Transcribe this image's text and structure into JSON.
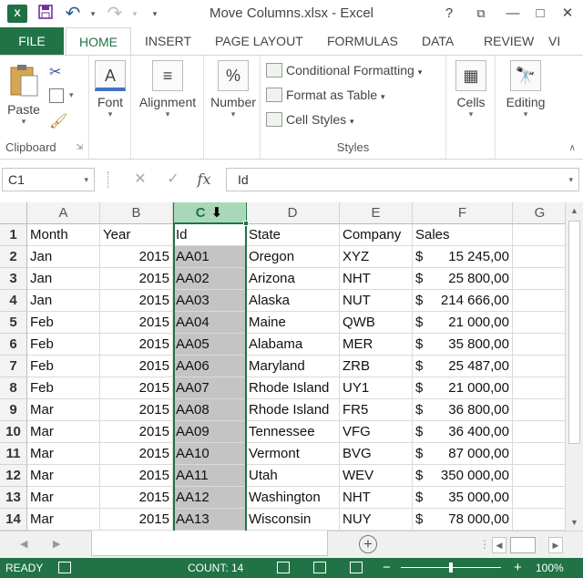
{
  "window": {
    "title": "Move Columns.xlsx - Excel",
    "help": "?",
    "restore": "⧉",
    "minimize": "—",
    "maximize": "□",
    "close": "✕"
  },
  "qat": {
    "app_icon": "X",
    "save": "💾",
    "undo": "↶",
    "redo": "↷",
    "customize": "▾"
  },
  "tabs": [
    "FILE",
    "HOME",
    "INSERT",
    "PAGE LAYOUT",
    "FORMULAS",
    "DATA",
    "REVIEW",
    "VI"
  ],
  "ribbon": {
    "clipboard": {
      "paste": "Paste",
      "label": "Clipboard"
    },
    "font": {
      "label": "Font",
      "icon": "A"
    },
    "alignment": {
      "label": "Alignment",
      "icon": "≡"
    },
    "number": {
      "label": "Number",
      "icon": "%"
    },
    "styles": {
      "conditional": "Conditional Formatting",
      "table": "Format as Table",
      "cell_styles": "Cell Styles",
      "label": "Styles"
    },
    "cells": {
      "label": "Cells"
    },
    "editing": {
      "label": "Editing"
    }
  },
  "formula_bar": {
    "name_box": "C1",
    "fx": "fx",
    "cancel": "✕",
    "enter": "✓",
    "value": "Id"
  },
  "columns": [
    "A",
    "B",
    "C",
    "D",
    "E",
    "F",
    "G"
  ],
  "column_c_marker": "🡻",
  "rows": [
    {
      "n": "1",
      "a": "Month",
      "b": "",
      "b_text": "Year",
      "c": "Id",
      "d": "State",
      "e": "Company",
      "f_cur": "",
      "f_val": "",
      "f_text": "Sales"
    },
    {
      "n": "2",
      "a": "Jan",
      "b": "2015",
      "c": "AA01",
      "d": "Oregon",
      "e": "XYZ",
      "f_cur": "$",
      "f_val": "15 245,00"
    },
    {
      "n": "3",
      "a": "Jan",
      "b": "2015",
      "c": "AA02",
      "d": "Arizona",
      "e": "NHT",
      "f_cur": "$",
      "f_val": "25 800,00"
    },
    {
      "n": "4",
      "a": "Jan",
      "b": "2015",
      "c": "AA03",
      "d": "Alaska",
      "e": "NUT",
      "f_cur": "$",
      "f_val": "214 666,00"
    },
    {
      "n": "5",
      "a": "Feb",
      "b": "2015",
      "c": "AA04",
      "d": "Maine",
      "e": "QWB",
      "f_cur": "$",
      "f_val": "21 000,00"
    },
    {
      "n": "6",
      "a": "Feb",
      "b": "2015",
      "c": "AA05",
      "d": "Alabama",
      "e": "MER",
      "f_cur": "$",
      "f_val": "35 800,00"
    },
    {
      "n": "7",
      "a": "Feb",
      "b": "2015",
      "c": "AA06",
      "d": "Maryland",
      "e": "ZRB",
      "f_cur": "$",
      "f_val": "25 487,00"
    },
    {
      "n": "8",
      "a": "Feb",
      "b": "2015",
      "c": "AA07",
      "d": "Rhode Island",
      "e": "UY1",
      "f_cur": "$",
      "f_val": "21 000,00"
    },
    {
      "n": "9",
      "a": "Mar",
      "b": "2015",
      "c": "AA08",
      "d": "Rhode Island",
      "e": "FR5",
      "f_cur": "$",
      "f_val": "36 800,00"
    },
    {
      "n": "10",
      "a": "Mar",
      "b": "2015",
      "c": "AA09",
      "d": "Tennessee",
      "e": "VFG",
      "f_cur": "$",
      "f_val": "36 400,00"
    },
    {
      "n": "11",
      "a": "Mar",
      "b": "2015",
      "c": "AA10",
      "d": "Vermont",
      "e": "BVG",
      "f_cur": "$",
      "f_val": "87 000,00"
    },
    {
      "n": "12",
      "a": "Mar",
      "b": "2015",
      "c": "AA11",
      "d": "Utah",
      "e": "WEV",
      "f_cur": "$",
      "f_val": "350 000,00"
    },
    {
      "n": "13",
      "a": "Mar",
      "b": "2015",
      "c": "AA12",
      "d": "Washington",
      "e": "NHT",
      "f_cur": "$",
      "f_val": "35 000,00"
    },
    {
      "n": "14",
      "a": "Mar",
      "b": "2015",
      "c": "AA13",
      "d": "Wisconsin",
      "e": "NUY",
      "f_cur": "$",
      "f_val": "78 000,00"
    }
  ],
  "sheetbar": {
    "add": "+"
  },
  "status": {
    "ready": "READY",
    "count": "COUNT: 14",
    "zoom": "100%",
    "minus": "−",
    "plus": "+"
  },
  "colors": {
    "accent": "#217346",
    "selected_header": "#a9d8b8",
    "selected_cells": "#c4c4c4"
  }
}
